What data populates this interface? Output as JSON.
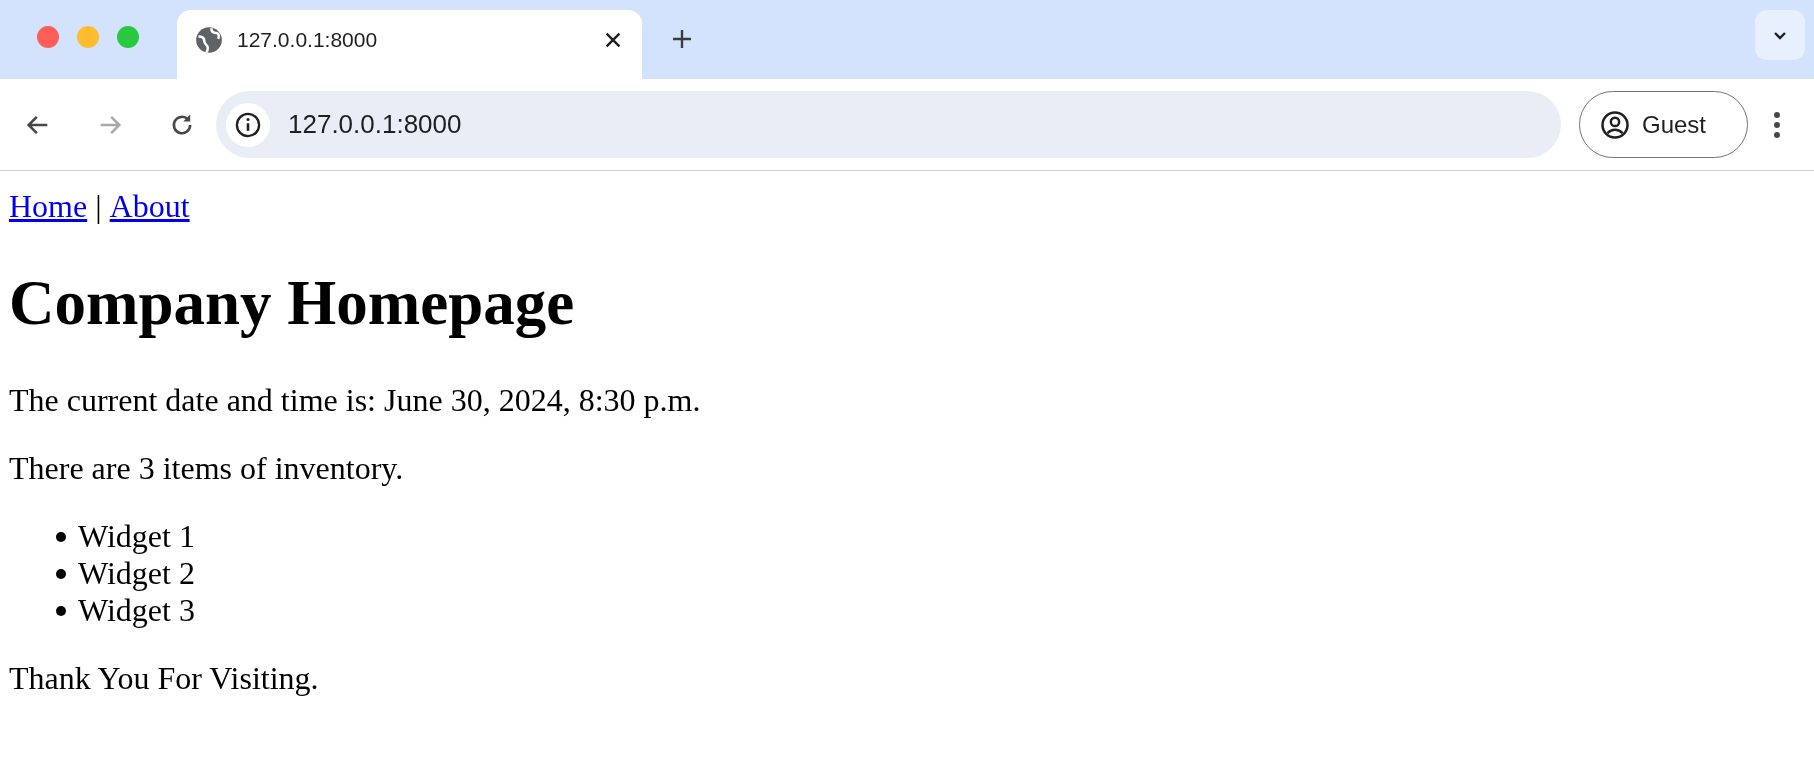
{
  "browser": {
    "tabs": [
      {
        "title": "127.0.0.1:8000",
        "selected": true
      }
    ],
    "address": "127.0.0.1:8000",
    "profile": "Guest"
  },
  "page": {
    "nav": [
      {
        "label": "Home"
      },
      {
        "label": "About"
      }
    ],
    "nav_separator": "|",
    "heading": "Company Homepage",
    "paragraphs": [
      "The current date and time is: June 30, 2024, 8:30 p.m.",
      "There are 3 items of inventory."
    ],
    "items": [
      "Widget 1",
      "Widget 2",
      "Widget 3"
    ],
    "footer": "Thank You For Visiting."
  }
}
